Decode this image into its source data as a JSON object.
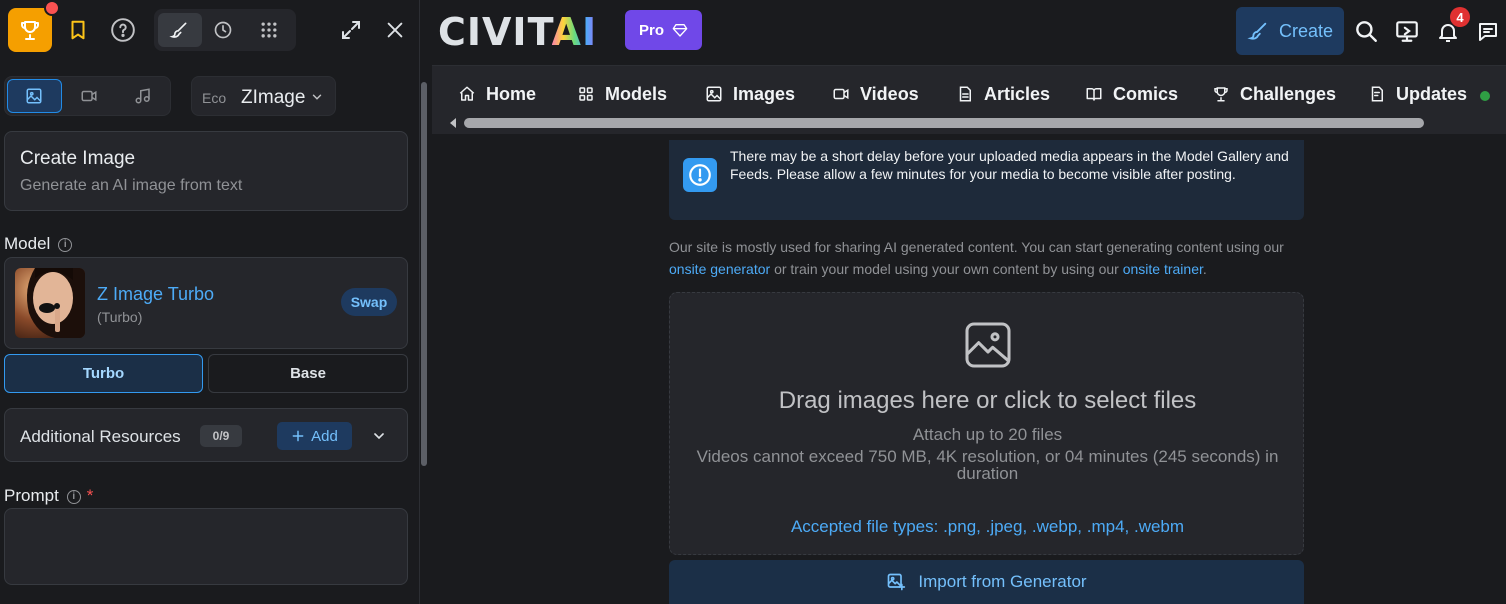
{
  "sidebar": {
    "model_type": {
      "label": "Eco",
      "value": "ZImage"
    },
    "create": {
      "title": "Create Image",
      "subtitle": "Generate an AI image from text"
    },
    "model_section": {
      "label": "Model",
      "name": "Z Image Turbo",
      "variant": "(Turbo)",
      "swap_label": "Swap"
    },
    "mode_toggle": {
      "options": [
        "Turbo",
        "Base"
      ],
      "selected": "Turbo"
    },
    "resources": {
      "label": "Additional Resources",
      "count": "0/9",
      "add_label": "Add"
    },
    "prompt": {
      "label": "Prompt",
      "required_mark": "*"
    }
  },
  "header": {
    "logo_part1": "CIVIT",
    "logo_part2": "AI",
    "pro_label": "Pro",
    "create_label": "Create",
    "notification_count": "4"
  },
  "nav": {
    "items": [
      "Home",
      "Models",
      "Images",
      "Videos",
      "Articles",
      "Comics",
      "Challenges",
      "Updates"
    ]
  },
  "main": {
    "notice": "There may be a short delay before your uploaded media appears in the Model Gallery and Feeds. Please allow a few minutes for your media to become visible after posting.",
    "desc": {
      "part1": "Our site is mostly used for sharing AI generated content. You can start generating content using our ",
      "link1": "onsite generator",
      "part2": " or train your model using your own content by using our ",
      "link2": "onsite trainer",
      "part3": "."
    },
    "dropzone": {
      "title": "Drag images here or click to select files",
      "sub1": "Attach up to 20 files",
      "sub2": "Videos cannot exceed 750 MB, 4K resolution, or 04 minutes (245 seconds) in duration",
      "types": "Accepted file types: .png, .jpeg, .webp, .mp4, .webm"
    },
    "import_label": "Import from Generator"
  },
  "colors": {
    "accent": "#339af0",
    "pro": "#7048e8",
    "trophy": "#f59f00",
    "background": "#1a1b1e"
  }
}
